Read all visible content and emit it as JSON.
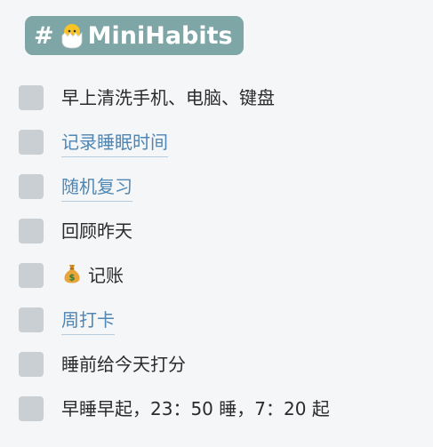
{
  "tag": {
    "hash": "#",
    "icon": "hatching-chick-icon",
    "name": "MiniHabits",
    "color": "#7ea6a6"
  },
  "habits": [
    {
      "text": "早上清洗手机、电脑、键盘",
      "link": false
    },
    {
      "text": "记录睡眠时间",
      "link": true
    },
    {
      "text": "随机复习",
      "link": true
    },
    {
      "text": "回顾昨天",
      "link": false
    },
    {
      "text": "记账",
      "link": false,
      "icon": "money-bag-icon"
    },
    {
      "text": "周打卡",
      "link": true
    },
    {
      "text": "睡前给今天打分",
      "link": false
    },
    {
      "text": "早睡早起，23：50 睡，7：20 起",
      "link": false
    }
  ],
  "colors": {
    "checkbox": "#c9cfd3",
    "link": "#4f86b3",
    "text": "#2b2b2b"
  }
}
